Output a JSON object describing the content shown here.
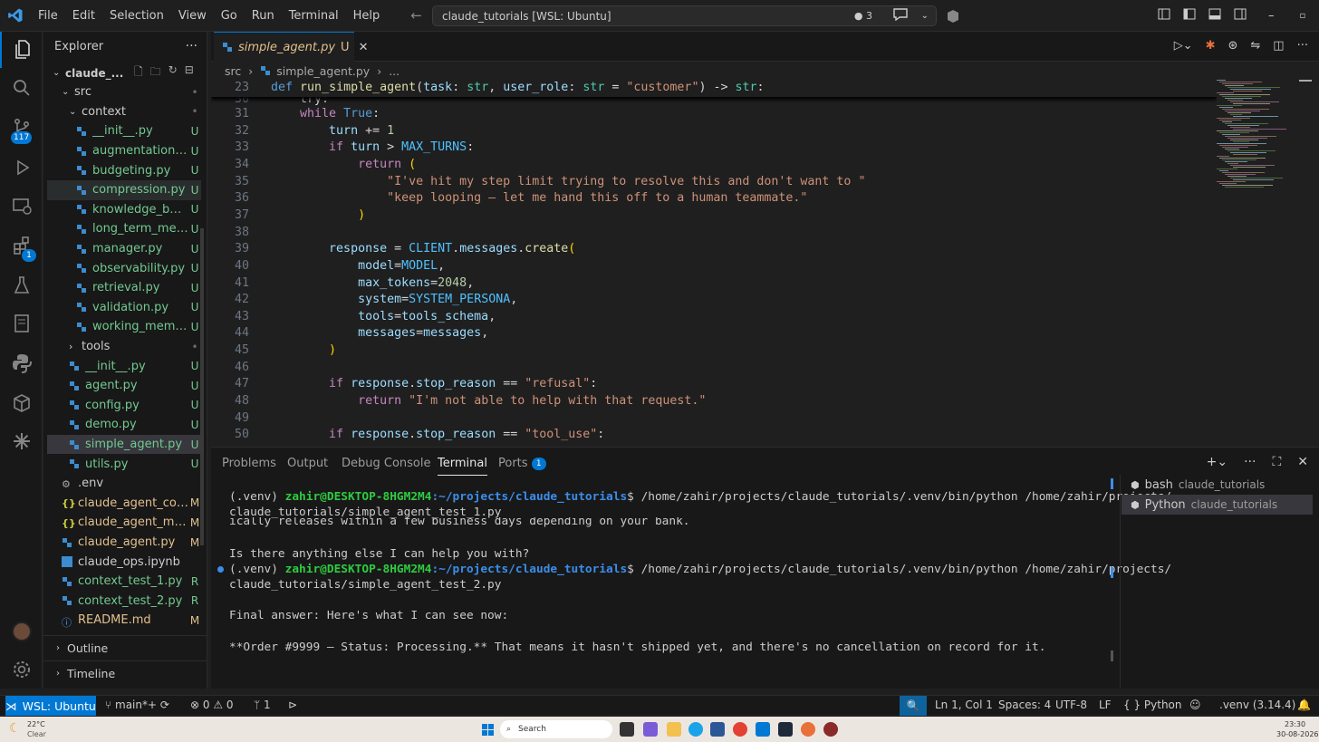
{
  "titlebar": {
    "menu": [
      "File",
      "Edit",
      "Selection",
      "View",
      "Go",
      "Run",
      "Terminal",
      "Help"
    ],
    "command_center": "claude_tutorials [WSL: Ubuntu]",
    "notif_count": "3"
  },
  "activity": {
    "scm_badge": "117",
    "ext_badge": "1"
  },
  "sidebar": {
    "title": "Explorer",
    "root": "claude_...",
    "items": [
      {
        "label": "src",
        "status": "•",
        "type": "folder-open",
        "indent": 1
      },
      {
        "label": "context",
        "status": "•",
        "type": "folder-open",
        "indent": 2
      },
      {
        "label": "__init__.py",
        "status": "U",
        "type": "py",
        "indent": 3
      },
      {
        "label": "augmentation.py",
        "status": "U",
        "type": "py",
        "indent": 3
      },
      {
        "label": "budgeting.py",
        "status": "U",
        "type": "py",
        "indent": 3
      },
      {
        "label": "compression.py",
        "status": "U",
        "type": "py",
        "indent": 3
      },
      {
        "label": "knowledge_base...",
        "status": "U",
        "type": "py",
        "indent": 3
      },
      {
        "label": "long_term_mem...",
        "status": "U",
        "type": "py",
        "indent": 3
      },
      {
        "label": "manager.py",
        "status": "U",
        "type": "py",
        "indent": 3
      },
      {
        "label": "observability.py",
        "status": "U",
        "type": "py",
        "indent": 3
      },
      {
        "label": "retrieval.py",
        "status": "U",
        "type": "py",
        "indent": 3
      },
      {
        "label": "validation.py",
        "status": "U",
        "type": "py",
        "indent": 3
      },
      {
        "label": "working_memor...",
        "status": "U",
        "type": "py",
        "indent": 3
      },
      {
        "label": "tools",
        "status": "•",
        "type": "folder",
        "indent": 2
      },
      {
        "label": "__init__.py",
        "status": "U",
        "type": "py",
        "indent": 2
      },
      {
        "label": "agent.py",
        "status": "U",
        "type": "py",
        "indent": 2
      },
      {
        "label": "config.py",
        "status": "U",
        "type": "py",
        "indent": 2
      },
      {
        "label": "demo.py",
        "status": "U",
        "type": "py",
        "indent": 2
      },
      {
        "label": "simple_agent.py",
        "status": "U",
        "type": "py",
        "indent": 2
      },
      {
        "label": "utils.py",
        "status": "U",
        "type": "py",
        "indent": 2
      },
      {
        "label": ".env",
        "status": "",
        "type": "gear",
        "indent": 1
      },
      {
        "label": "claude_agent_cont...",
        "status": "M",
        "type": "json",
        "indent": 1
      },
      {
        "label": "claude_agent_me...",
        "status": "M",
        "type": "json",
        "indent": 1
      },
      {
        "label": "claude_agent.py",
        "status": "M",
        "type": "py",
        "indent": 1
      },
      {
        "label": "claude_ops.ipynb",
        "status": "",
        "type": "nb",
        "indent": 1
      },
      {
        "label": "context_test_1.py",
        "status": "R",
        "type": "py",
        "indent": 1
      },
      {
        "label": "context_test_2.py",
        "status": "R",
        "type": "py",
        "indent": 1
      },
      {
        "label": "README.md",
        "status": "M",
        "type": "md",
        "indent": 1
      }
    ],
    "outline": "Outline",
    "timeline": "Timeline"
  },
  "editor": {
    "tab_label": "simple_agent.py",
    "tab_status": "U",
    "breadcrumb": [
      "src",
      "simple_agent.py",
      "..."
    ],
    "sticky": {
      "n": "23",
      "html": "<span class='bl'>def</span> <span class='fn'>run_simple_agent</span><span class='pl'>(</span><span class='var'>task</span><span class='pl'>: </span><span class='ty'>str</span><span class='pl'>, </span><span class='var'>user_role</span><span class='pl'>: </span><span class='ty'>str</span><span class='pl'> = </span><span class='str'>\"customer\"</span><span class='pl'>) -> </span><span class='ty'>str</span><span class='pl'>:</span>"
    },
    "lines": [
      {
        "n": "31",
        "html": "<span class='pl'>    </span><span class='kw'>while</span> <span class='bl'>True</span><span class='pl'>:</span>"
      },
      {
        "n": "32",
        "html": "<span class='pl'>        </span><span class='var'>turn</span><span class='pl'> += </span><span class='num'>1</span>"
      },
      {
        "n": "33",
        "html": "<span class='pl'>        </span><span class='kw'>if</span> <span class='var'>turn</span><span class='pl'> > </span><span class='cn'>MAX_TURNS</span><span class='pl'>:</span>"
      },
      {
        "n": "34",
        "html": "<span class='pl'>            </span><span class='kw'>return</span> <span class='br'>(</span>"
      },
      {
        "n": "35",
        "html": "<span class='pl'>                </span><span class='str'>\"I've hit my step limit trying to resolve this and don't want to \"</span>"
      },
      {
        "n": "36",
        "html": "<span class='pl'>                </span><span class='str'>\"keep looping — let me hand this off to a human teammate.\"</span>"
      },
      {
        "n": "37",
        "html": "<span class='pl'>            </span><span class='br'>)</span>"
      },
      {
        "n": "38",
        "html": ""
      },
      {
        "n": "39",
        "html": "<span class='pl'>        </span><span class='var'>response</span><span class='pl'> = </span><span class='cn'>CLIENT</span><span class='pl'>.</span><span class='var'>messages</span><span class='pl'>.</span><span class='fn'>create</span><span class='br'>(</span>"
      },
      {
        "n": "40",
        "html": "<span class='pl'>            </span><span class='var'>model</span><span class='pl'>=</span><span class='cn'>MODEL</span><span class='pl'>,</span>"
      },
      {
        "n": "41",
        "html": "<span class='pl'>            </span><span class='var'>max_tokens</span><span class='pl'>=</span><span class='num'>2048</span><span class='pl'>,</span>"
      },
      {
        "n": "42",
        "html": "<span class='pl'>            </span><span class='var'>system</span><span class='pl'>=</span><span class='cn'>SYSTEM_PERSONA</span><span class='pl'>,</span>"
      },
      {
        "n": "43",
        "html": "<span class='pl'>            </span><span class='var'>tools</span><span class='pl'>=</span><span class='var'>tools_schema</span><span class='pl'>,</span>"
      },
      {
        "n": "44",
        "html": "<span class='pl'>            </span><span class='var'>messages</span><span class='pl'>=</span><span class='var'>messages</span><span class='pl'>,</span>"
      },
      {
        "n": "45",
        "html": "<span class='pl'>        </span><span class='br'>)</span>"
      },
      {
        "n": "46",
        "html": ""
      },
      {
        "n": "47",
        "html": "<span class='pl'>        </span><span class='kw'>if</span> <span class='var'>response</span><span class='pl'>.</span><span class='var'>stop_reason</span><span class='pl'> == </span><span class='str'>\"refusal\"</span><span class='pl'>:</span>"
      },
      {
        "n": "48",
        "html": "<span class='pl'>            </span><span class='kw'>return</span> <span class='str'>\"I'm not able to help with that request.\"</span>"
      },
      {
        "n": "49",
        "html": ""
      },
      {
        "n": "50",
        "html": "<span class='pl'>        </span><span class='kw'>if</span> <span class='var'>response</span><span class='pl'>.</span><span class='var'>stop_reason</span><span class='pl'> == </span><span class='str'>\"tool_use\"</span><span class='pl'>:</span>"
      }
    ]
  },
  "panel": {
    "tabs": [
      "Problems",
      "Output",
      "Debug Console",
      "Terminal",
      "Ports"
    ],
    "ports_badge": "1",
    "terminal_lines": [
      {
        "prompt_venv": "(.venv) ",
        "user": "zahir@DESKTOP-8HGM2M4",
        "path": ":~/projects/claude_tutorials",
        "cmd": "$ /home/zahir/projects/claude_tutorials/.venv/bin/python /home/zahir/projects/"
      },
      {
        "text": "claude_tutorials/simple_agent_test_1.py"
      },
      {
        "text": "ically releases within a few business days depending on your bank."
      },
      {
        "text": ""
      },
      {
        "text": "Is there anything else I can help you with?"
      },
      {
        "prompt_venv": "(.venv) ",
        "user": "zahir@DESKTOP-8HGM2M4",
        "path": ":~/projects/claude_tutorials",
        "cmd": "$ /home/zahir/projects/claude_tutorials/.venv/bin/python /home/zahir/projects/"
      },
      {
        "text": "claude_tutorials/simple_agent_test_2.py"
      },
      {
        "text": ""
      },
      {
        "text": "Final answer: Here's what I can see now:"
      },
      {
        "text": ""
      },
      {
        "text": "**Order #9999 — Status: Processing.** That means it hasn't shipped yet, and there's no cancellation on record for it."
      }
    ],
    "terminals": [
      {
        "name": "bash",
        "cwd": "claude_tutorials"
      },
      {
        "name": "Python",
        "cwd": "claude_tutorials"
      }
    ]
  },
  "status": {
    "remote": "WSL: Ubuntu",
    "branch": "main*+",
    "errors": "0",
    "warnings": "0",
    "ports": "1",
    "position": "Ln 1, Col 1",
    "spaces": "Spaces: 4",
    "encoding": "UTF-8",
    "eol": "LF",
    "language": "Python",
    "interpreter": ".venv (3.14.4)"
  },
  "taskbar": {
    "weather_temp": "22°C",
    "weather_desc": "Clear",
    "search_placeholder": "Search",
    "time": "23:30",
    "date": "30-08-2026"
  }
}
